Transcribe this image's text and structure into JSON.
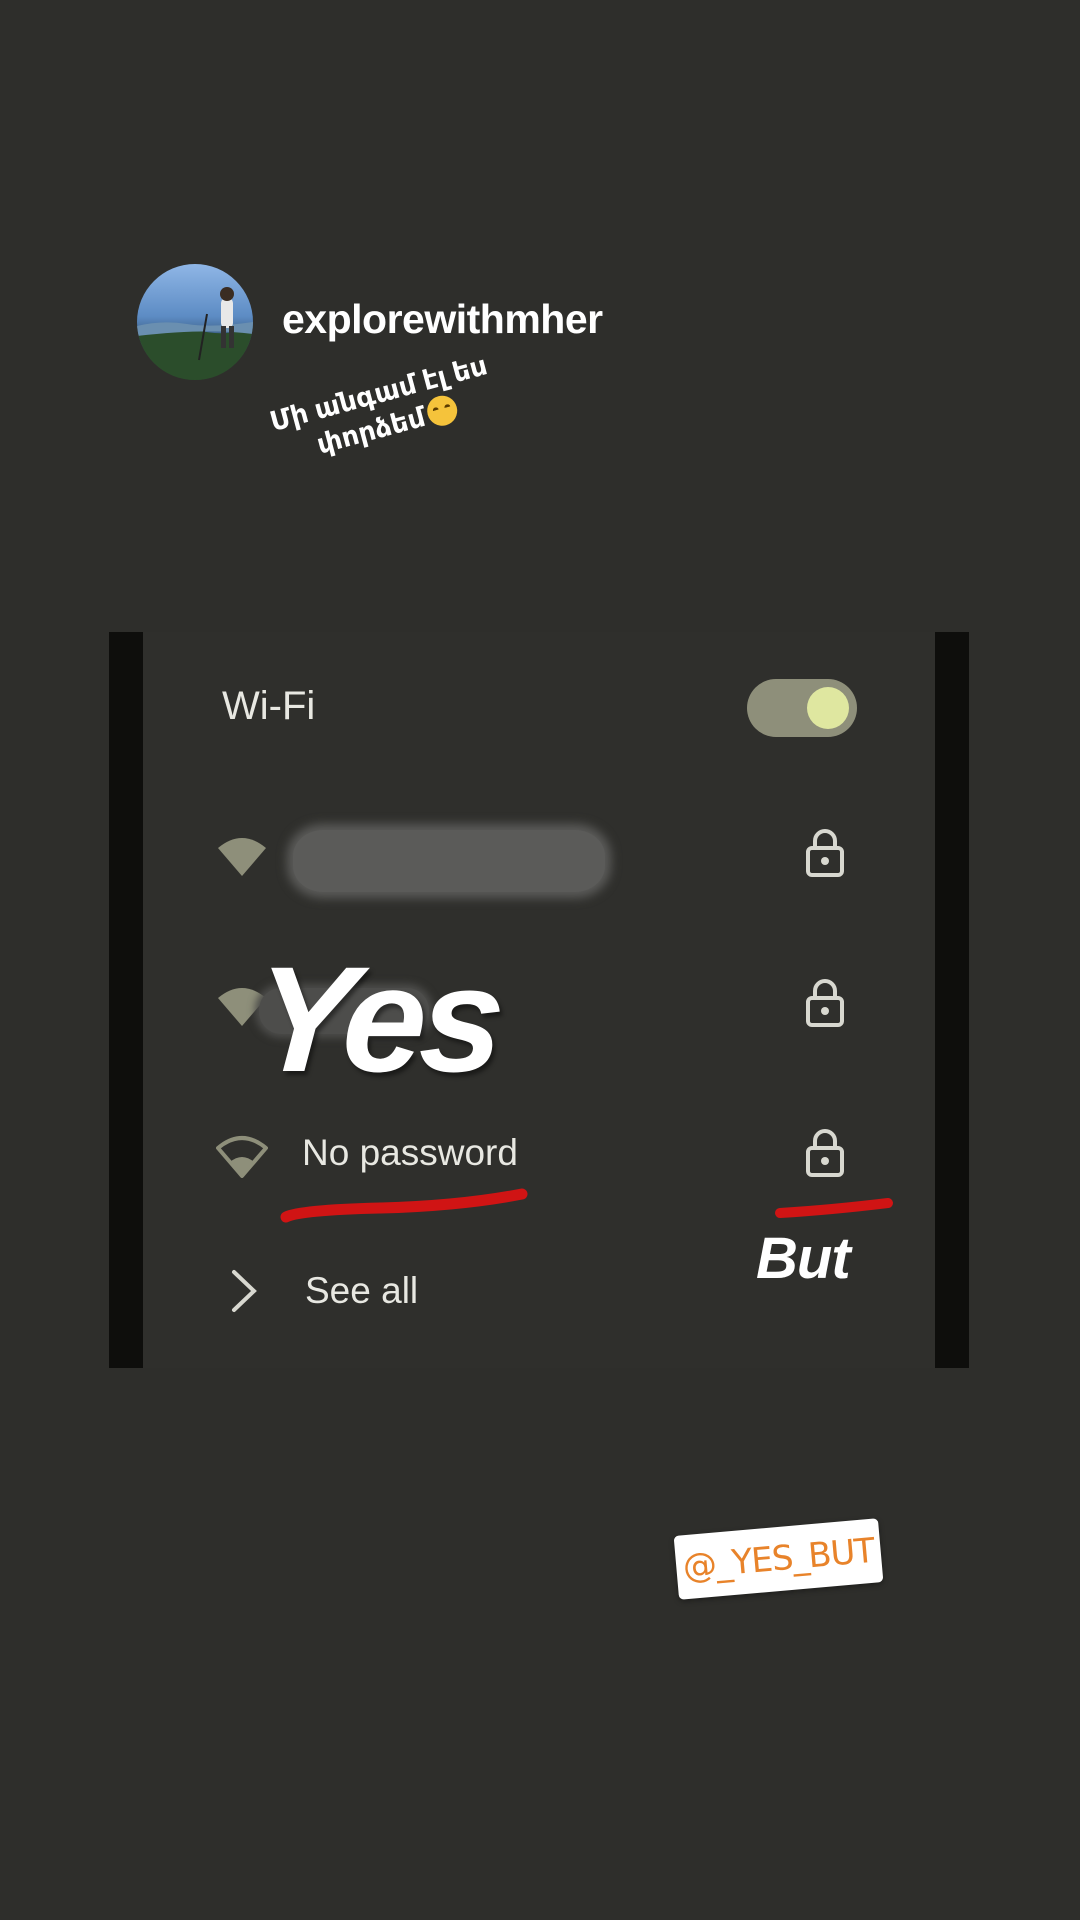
{
  "post": {
    "username": "explorewithmher",
    "caption_line1": "Մի անգամ էլ ես",
    "caption_line2": "փորձեմ",
    "caption_emoji": "sweat-smile-emoji"
  },
  "wifi_panel": {
    "title": "Wi-Fi",
    "toggle_on": true,
    "networks": [
      {
        "label": "",
        "redacted": true,
        "locked": true,
        "icon": "wifi-icon"
      },
      {
        "label": "",
        "redacted": true,
        "locked": true,
        "icon": "wifi-icon"
      },
      {
        "label": "No password",
        "redacted": false,
        "locked": true,
        "icon": "wifi-icon"
      }
    ],
    "see_all_label": "See all"
  },
  "stickers": {
    "yes": "Yes",
    "but": "But",
    "handle": "@_YES_BUT"
  },
  "colors": {
    "background": "#2e2e2b",
    "underline_red": "#d01414",
    "toggle_knob": "#dfe7a0",
    "handle_orange": "#e8832a"
  }
}
